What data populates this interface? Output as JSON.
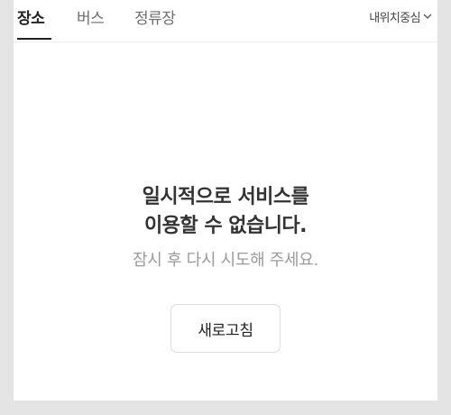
{
  "tabs": [
    {
      "label": "장소",
      "active": true
    },
    {
      "label": "버스",
      "active": false
    },
    {
      "label": "정류장",
      "active": false
    }
  ],
  "location_filter": {
    "label": "내위치중심",
    "icon": "chevron-down-icon"
  },
  "message": {
    "title_line1": "일시적으로 서비스를",
    "title_line2": "이용할 수 없습니다.",
    "subtitle": "잠시 후 다시 시도해 주세요."
  },
  "refresh_button": {
    "label": "새로고침"
  },
  "colors": {
    "background": "#e4e4e4",
    "panel": "#ffffff",
    "active_tab": "#222222",
    "inactive_tab": "#6e6e6e",
    "subtitle": "#9a9a9a"
  }
}
